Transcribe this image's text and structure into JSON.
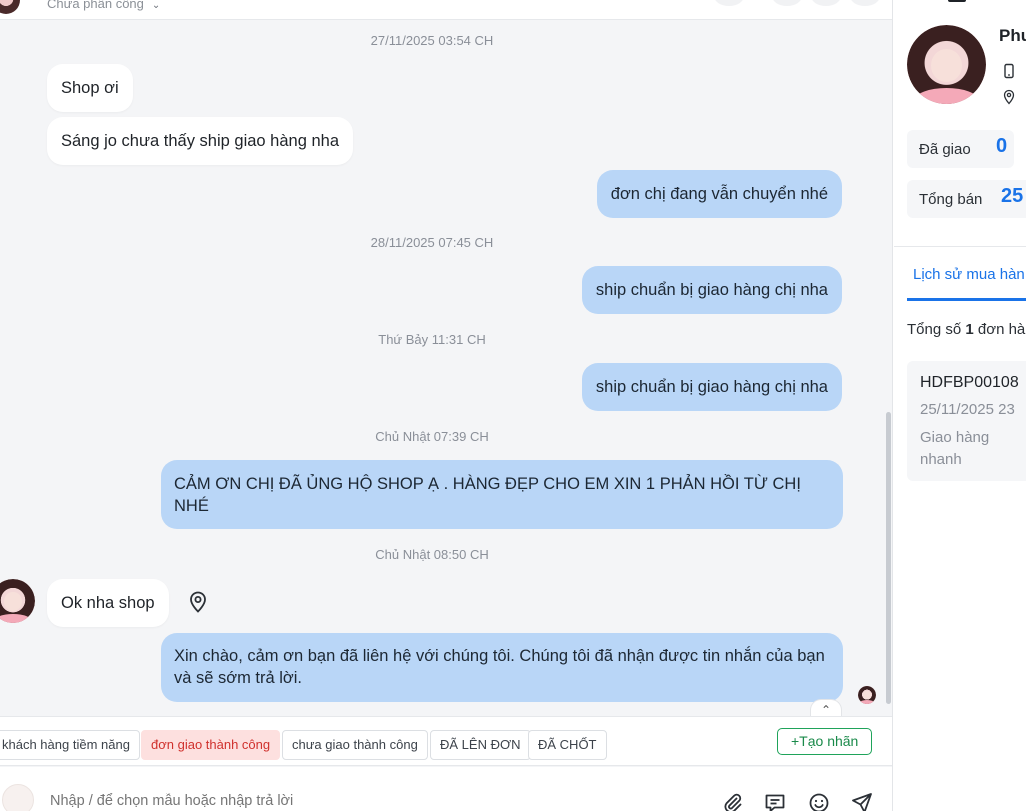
{
  "header": {
    "assign_label": "Chưa phân công",
    "dropdown_glyph": "⌄"
  },
  "messages": [
    {
      "type": "timestamp",
      "text": "27/11/2025 03:54 CH"
    },
    {
      "type": "incoming",
      "text": "Shop ơi"
    },
    {
      "type": "incoming",
      "text": "Sáng jo chưa thấy ship giao hàng nha"
    },
    {
      "type": "outgoing",
      "text": "đơn chị đang vẫn chuyển nhé"
    },
    {
      "type": "timestamp",
      "text": "28/11/2025 07:45 CH"
    },
    {
      "type": "outgoing",
      "text": "ship chuẩn bị giao hàng chị nha"
    },
    {
      "type": "timestamp",
      "text": "Thứ Bảy 11:31 CH"
    },
    {
      "type": "outgoing",
      "text": "ship chuẩn bị giao hàng chị nha"
    },
    {
      "type": "timestamp",
      "text": "Chủ Nhật 07:39 CH"
    },
    {
      "type": "outgoing",
      "text": "CẢM ƠN CHỊ ĐÃ ỦNG HỘ SHOP Ạ . HÀNG ĐẸP CHO EM XIN 1 PHẢN HỒI TỪ CHỊ NHÉ"
    },
    {
      "type": "timestamp",
      "text": "Chủ Nhật 08:50 CH"
    },
    {
      "type": "incoming",
      "text": "Ok nha shop"
    },
    {
      "type": "outgoing",
      "text": "Xin chào, cảm ơn bạn đã liên hệ với chúng tôi. Chúng tôi đã nhận được tin nhắn của bạn và sẽ sớm trả lời."
    }
  ],
  "scroll_top_glyph": "⌃",
  "tags": [
    {
      "label": "khách hàng tiềm năng",
      "style": "default"
    },
    {
      "label": "đơn giao thành công",
      "style": "danger"
    },
    {
      "label": "chưa giao thành công",
      "style": "default"
    },
    {
      "label": "ĐÃ LÊN ĐƠN",
      "style": "default"
    },
    {
      "label": "ĐÃ CHỐT",
      "style": "default"
    }
  ],
  "create_tag_label": "+Tạo nhãn",
  "composer": {
    "placeholder": "Nhập / để chọn mẫu hoặc nhập trả lời",
    "tools": [
      "attach-icon",
      "template-icon",
      "emoji-icon",
      "send-icon"
    ]
  },
  "customer": {
    "name": "Phư",
    "stats": [
      {
        "label": "Đã giao",
        "value": "0"
      },
      {
        "label": "Tổng bán",
        "value": "25"
      }
    ],
    "history_tab": "Lịch sử mua hàn",
    "total_prefix": "Tổng số ",
    "total_count": "1",
    "total_suffix": " đơn hà",
    "order": {
      "id": "HDFBP00108",
      "date": "25/11/2025 23",
      "shipping": "Giao hàng nhanh"
    }
  },
  "colors": {
    "accent": "#1a73e8",
    "outgoing_bubble": "#b9d6f7",
    "incoming_bubble": "#ffffff",
    "danger_tag_bg": "#fde0df",
    "create_tag": "#1fa35a"
  }
}
